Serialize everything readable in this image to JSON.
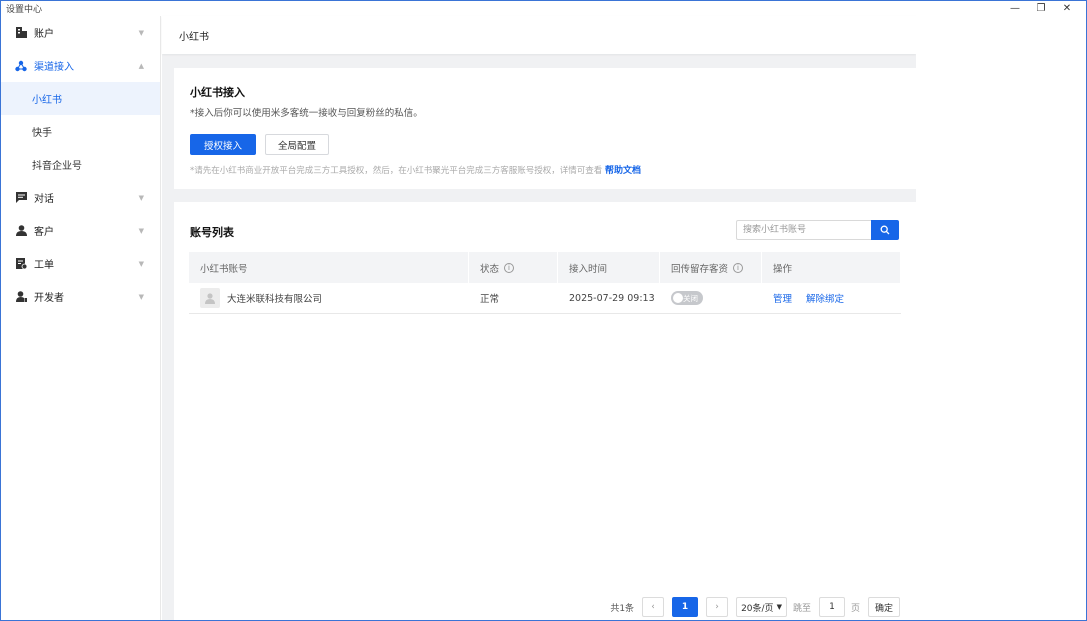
{
  "window": {
    "title": "设置中心",
    "min": "—",
    "max": "❐",
    "close": "✕"
  },
  "sidebar": {
    "groups": [
      {
        "label": "账户",
        "icon": "building-icon"
      },
      {
        "label": "渠道接入",
        "icon": "channel-icon",
        "expanded": true,
        "items": [
          {
            "label": "小红书"
          },
          {
            "label": "快手"
          },
          {
            "label": "抖音企业号"
          }
        ]
      },
      {
        "label": "对话",
        "icon": "chat-icon"
      },
      {
        "label": "客户",
        "icon": "user-icon"
      },
      {
        "label": "工单",
        "icon": "ticket-icon"
      },
      {
        "label": "开发者",
        "icon": "developer-icon"
      }
    ]
  },
  "header": {
    "title": "小红书"
  },
  "integration": {
    "title": "小红书接入",
    "description": "*接入后你可以使用米多客统一接收与回复粉丝的私信。",
    "authorize_button": "授权接入",
    "global_config_button": "全局配置",
    "tip": "*请先在小红书商业开放平台完成三方工具授权，然后，在小红书聚光平台完成三方客服账号授权，详情可查看",
    "help_link": "帮助文档"
  },
  "accounts": {
    "title": "账号列表",
    "search_placeholder": "搜索小红书账号",
    "columns": [
      "小红书账号",
      "状态",
      "接入时间",
      "回传留存客资",
      "操作"
    ],
    "rows": [
      {
        "name": "大连米联科技有限公司",
        "status": "正常",
        "time": "2025-07-29 09:13",
        "toggle": "关闭",
        "actions": [
          "管理",
          "解除绑定"
        ]
      }
    ]
  },
  "pagination": {
    "total": "共1条",
    "prev": "‹",
    "current": "1",
    "next": "›",
    "page_size": "20条/页",
    "jump_label": "跳至",
    "jump_value": "1",
    "page_unit": "页",
    "confirm": "确定"
  }
}
